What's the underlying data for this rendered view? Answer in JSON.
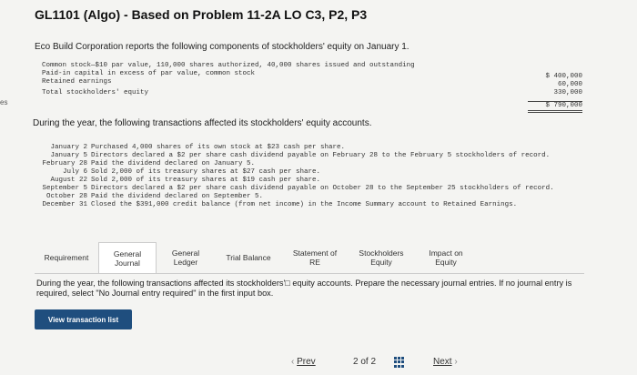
{
  "sidebar": {
    "tab_label": "es"
  },
  "header": {
    "title": "GL1101 (Algo) - Based on Problem 11-2A LO C3, P2, P3"
  },
  "intro": "Eco Build Corporation reports the following components of stockholders' equity on January 1.",
  "equity": {
    "rows": [
      {
        "label": "Common stock—$10 par value, 110,000 shares authorized, 40,000 shares issued and outstanding",
        "amount": "$ 400,000"
      },
      {
        "label": "Paid-in capital in excess of par value, common stock",
        "amount": "60,000"
      },
      {
        "label": "Retained earnings",
        "amount": "330,000"
      },
      {
        "label": "Total stockholders' equity",
        "amount": "$ 790,000"
      }
    ]
  },
  "during_text": "During the year, the following transactions affected its stockholders' equity accounts.",
  "transactions": [
    {
      "date": "January 2",
      "text": "Purchased 4,000 shares of its own stock at $23 cash per share."
    },
    {
      "date": "January 5",
      "text": "Directors declared a $2 per share cash dividend payable on February 28 to the February 5 stockholders of record."
    },
    {
      "date": "February 28",
      "text": "Paid the dividend declared on January 5."
    },
    {
      "date": "July 6",
      "text": "Sold 2,000 of its treasury shares at $27 cash per share."
    },
    {
      "date": "August 22",
      "text": "Sold 2,000 of its treasury shares at $19 cash per share."
    },
    {
      "date": "September 5",
      "text": "Directors declared a $2 per share cash dividend payable on October 28 to the September 25 stockholders of record."
    },
    {
      "date": "October 28",
      "text": "Paid the dividend declared on September 5."
    },
    {
      "date": "December 31",
      "text": "Closed the $391,000 credit balance (from net income) in the Income Summary account to Retained Earnings."
    }
  ],
  "tabs": [
    {
      "label": "Requirement"
    },
    {
      "label": "General Journal"
    },
    {
      "label": "General Ledger"
    },
    {
      "label": "Trial Balance"
    },
    {
      "label": "Statement of RE"
    },
    {
      "label": "Stockholders Equity"
    },
    {
      "label": "Impact on Equity"
    }
  ],
  "instructions": "During the year, the following transactions affected its stockholders'□ equity accounts. Prepare the necessary journal entries. If no journal entry is required, select \"No Journal entry required\" in the first input box.",
  "view_button": "View transaction list",
  "pager": {
    "prev": "Prev",
    "page": "2 of 2",
    "next": "Next"
  }
}
